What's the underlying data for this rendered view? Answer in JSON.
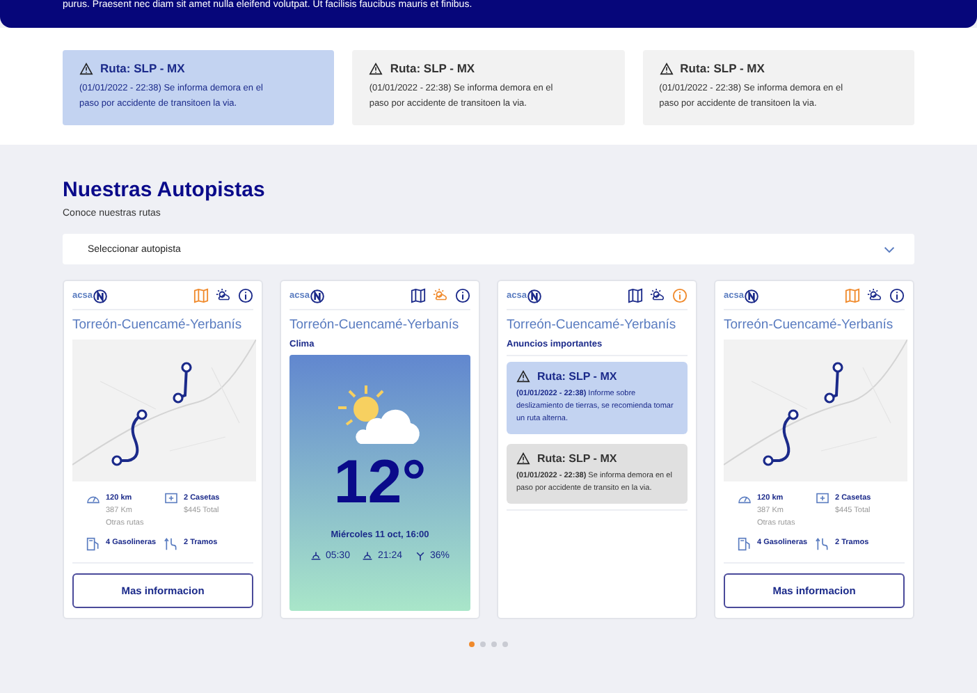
{
  "banner": {
    "text": "purus. Praesent nec diam sit amet nulla eleifend volutpat. Ut facilisis faucibus mauris et finibus."
  },
  "alerts": [
    {
      "title": "Ruta: SLP - MX",
      "text": "(01/01/2022 - 22:38) Se informa demora en el paso por accidente de transitoen la via.",
      "selected": true
    },
    {
      "title": "Ruta: SLP - MX",
      "text": "(01/01/2022 - 22:38) Se informa demora en el paso por accidente de transitoen la via.",
      "selected": false
    },
    {
      "title": "Ruta: SLP - MX",
      "text": "(01/01/2022 - 22:38) Se informa demora en el paso por accidente de transitoen la via.",
      "selected": false
    }
  ],
  "section": {
    "title": "Nuestras Autopistas",
    "subtitle": "Conoce nuestras rutas",
    "select": {
      "placeholder": "Seleccionar autopista"
    }
  },
  "cards": [
    {
      "kind": "map",
      "logo": "acsa",
      "title": "Torreón-Cuencamé-Yerbanís",
      "tabs": [
        {
          "kind": "map",
          "selected": true
        },
        {
          "kind": "weather",
          "selected": false
        },
        {
          "kind": "info",
          "selected": false
        }
      ],
      "stats": {
        "distance": "120 km",
        "distance_alt": "387 Km",
        "distance_note": "Otras rutas",
        "tolls": "2 Casetas",
        "tolls_total": "$445 Total",
        "gas": "4 Gasolineras",
        "sections": "2 Tramos"
      },
      "button": "Mas informacion"
    },
    {
      "kind": "weather",
      "logo": "acsa",
      "title": "Torreón-Cuencamé-Yerbanís",
      "tabs": [
        {
          "kind": "map",
          "selected": false
        },
        {
          "kind": "weather",
          "selected": true
        },
        {
          "kind": "info",
          "selected": false
        }
      ],
      "heading": "Clima",
      "temperature": "12°",
      "date": "Miércoles 11 oct, 16:00",
      "sunrise": "05:30",
      "sunset": "21:24",
      "humidity": "36%"
    },
    {
      "kind": "notices",
      "logo": "acsa",
      "title": "Torreón-Cuencamé-Yerbanís",
      "tabs": [
        {
          "kind": "map",
          "selected": false
        },
        {
          "kind": "weather",
          "selected": false
        },
        {
          "kind": "info",
          "selected": true
        }
      ],
      "heading": "Anuncios importantes",
      "notices": [
        {
          "title": "Ruta: SLP - MX",
          "text": "**(01/01/2022 - 22:38)** Informe sobre deslizamiento de tierras, se recomienda tomar un ruta alterna.",
          "selected": true
        },
        {
          "title": "Ruta: SLP - MX",
          "text": "**(01/01/2022 - 22:38)** Se informa demora en el paso por accidente de transito en la via.",
          "selected": false
        }
      ]
    },
    {
      "kind": "map",
      "logo": "acsa",
      "title": "Torreón-Cuencamé-Yerbanís",
      "tabs": [
        {
          "kind": "map",
          "selected": true
        },
        {
          "kind": "weather",
          "selected": false
        },
        {
          "kind": "info",
          "selected": false
        }
      ],
      "stats": {
        "distance": "120 km",
        "distance_alt": "387 Km",
        "distance_note": "Otras rutas",
        "tolls": "2 Casetas",
        "tolls_total": "$445 Total",
        "gas": "4 Gasolineras",
        "sections": "2 Tramos"
      },
      "button": "Mas informacion"
    }
  ],
  "pager": [
    {
      "selected": true
    },
    {
      "selected": false
    },
    {
      "selected": false
    },
    {
      "selected": false
    }
  ]
}
